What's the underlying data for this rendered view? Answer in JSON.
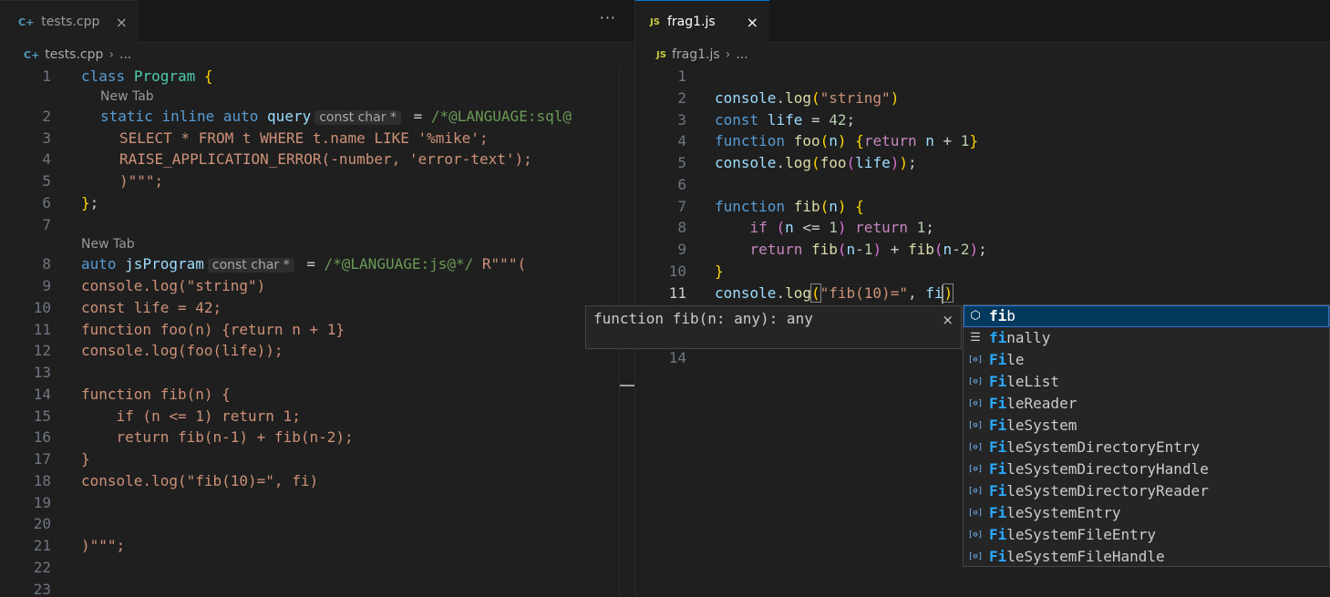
{
  "left": {
    "tab": {
      "icon": "C+",
      "label": "tests.cpp",
      "close": "×"
    },
    "more": "···",
    "breadcrumb": {
      "file": "tests.cpp",
      "rest": "..."
    },
    "lens1": "New Tab",
    "lens2": "New Tab",
    "hint": "const char *",
    "line_numbers": [
      "1",
      "2",
      "3",
      "4",
      "5",
      "6",
      "7",
      "8",
      "9",
      "10",
      "11",
      "12",
      "13",
      "14",
      "15",
      "16",
      "17",
      "18",
      "19",
      "20",
      "21",
      "22",
      "23"
    ],
    "code": {
      "l1": {
        "kw": "class",
        "name": "Program",
        "brace": "{"
      },
      "l2": {
        "static": "static",
        "inline": "inline",
        "auto": "auto",
        "name": "query",
        "eq": " = ",
        "cmt": "/*@LANGUAGE:sql@"
      },
      "l3": "SELECT * FROM t WHERE t.name LIKE '%mike';",
      "l4": "RAISE_APPLICATION_ERROR(-number, 'error-text');",
      "l5": ")\"\"\";",
      "l6": {
        "brace": "}",
        "semi": ";"
      },
      "l8": {
        "auto": "auto",
        "name": "jsProgram",
        "eq": " = ",
        "cmt": "/*@LANGUAGE:js@*/",
        "rest": " R\"\"\"("
      },
      "l9": "console.log(\"string\")",
      "l10": "const life = 42;",
      "l11": "function foo(n) {return n + 1}",
      "l12": "console.log(foo(life));",
      "l14": "function fib(n) {",
      "l15": "    if (n <= 1) return 1;",
      "l16": "    return fib(n-1) + fib(n-2);",
      "l17": "}",
      "l18": "console.log(\"fib(10)=\", fi)",
      "l21": ")\"\"\";"
    }
  },
  "right": {
    "tab": {
      "icon": "JS",
      "label": "frag1.js",
      "close": "×"
    },
    "breadcrumb": {
      "file": "frag1.js",
      "rest": "..."
    },
    "line_numbers": [
      "1",
      "2",
      "3",
      "4",
      "5",
      "6",
      "7",
      "8",
      "9",
      "10",
      "11",
      "14"
    ],
    "code": {
      "l2": {
        "obj": "console",
        "dot": ".",
        "fn": "log",
        "open": "(",
        "str": "\"string\"",
        "close": ")"
      },
      "l3": {
        "kw": "const",
        "name": "life",
        "eq": " = ",
        "num": "42",
        "semi": ";"
      },
      "l4": {
        "kw": "function",
        "name": "foo",
        "p1": "(",
        "arg": "n",
        "p2": ")",
        "b1": "{",
        "ret": "return",
        "n": "n",
        "plus": " + ",
        "num": "1",
        "b2": "}"
      },
      "l5": {
        "obj": "console",
        "fn": "log",
        "inner": "foo",
        "arg": "life",
        "end": "));"
      },
      "l7": {
        "kw": "function",
        "name": "fib",
        "arg": "n",
        "brace": "{"
      },
      "l8": {
        "if": "if",
        "cond": "n <= 1",
        "ret": "return",
        "num": "1",
        "semi": ";"
      },
      "l9": {
        "ret": "return",
        "fib": "fib",
        "a1": "n-1",
        "plus": " + ",
        "a2": "n-2",
        "semi": ";"
      },
      "l10": "}",
      "l11": {
        "obj": "console",
        "fn": "log",
        "str": "\"fib(10)=\"",
        "comma": ", ",
        "typed": "fi"
      }
    }
  },
  "hover": {
    "signature": "function fib(n: any): any",
    "close": "×"
  },
  "suggestions": [
    {
      "label": "fib",
      "icon": "cube-icon",
      "glyph": "⬡",
      "match": "fi",
      "rest": "b"
    },
    {
      "label": "finally",
      "icon": "keyword-icon",
      "glyph": "☰",
      "match": "fi",
      "rest": "nally"
    },
    {
      "label": "File",
      "icon": "variable-icon",
      "glyph": "[⊖]",
      "match": "Fi",
      "rest": "le"
    },
    {
      "label": "FileList",
      "icon": "variable-icon",
      "glyph": "[⊖]",
      "match": "Fi",
      "rest": "leList"
    },
    {
      "label": "FileReader",
      "icon": "variable-icon",
      "glyph": "[⊖]",
      "match": "Fi",
      "rest": "leReader"
    },
    {
      "label": "FileSystem",
      "icon": "variable-icon",
      "glyph": "[⊖]",
      "match": "Fi",
      "rest": "leSystem"
    },
    {
      "label": "FileSystemDirectoryEntry",
      "icon": "variable-icon",
      "glyph": "[⊖]",
      "match": "Fi",
      "rest": "leSystemDirectoryEntry"
    },
    {
      "label": "FileSystemDirectoryHandle",
      "icon": "variable-icon",
      "glyph": "[⊖]",
      "match": "Fi",
      "rest": "leSystemDirectoryHandle"
    },
    {
      "label": "FileSystemDirectoryReader",
      "icon": "variable-icon",
      "glyph": "[⊖]",
      "match": "Fi",
      "rest": "leSystemDirectoryReader"
    },
    {
      "label": "FileSystemEntry",
      "icon": "variable-icon",
      "glyph": "[⊖]",
      "match": "Fi",
      "rest": "leSystemEntry"
    },
    {
      "label": "FileSystemFileEntry",
      "icon": "variable-icon",
      "glyph": "[⊖]",
      "match": "Fi",
      "rest": "leSystemFileEntry"
    },
    {
      "label": "FileSystemFileHandle",
      "icon": "variable-icon",
      "glyph": "[⊖]",
      "match": "Fi",
      "rest": "leSystemFileHandle"
    }
  ]
}
